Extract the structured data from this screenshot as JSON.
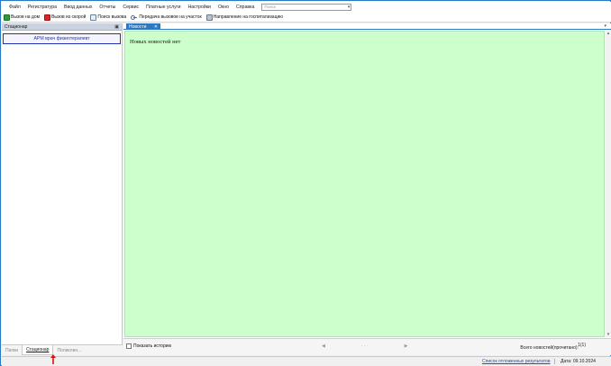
{
  "menu": {
    "items": [
      "Файл",
      "Регистратура",
      "Ввод данных",
      "Отчеты",
      "Сервис",
      "Платные услуги",
      "Настройки",
      "Окно",
      "Справка"
    ],
    "search_placeholder": "Поиск"
  },
  "toolbar": {
    "home_call": "Вызов на дом",
    "ambulance_call": "Вызов из скорой",
    "call_search": "Поиск вызова",
    "transfer_calls": "Передача вызовов на участок",
    "hospital_referral": "Направление на госпитализацию"
  },
  "left_panel": {
    "title": "Стационар",
    "workplace_button": "АРМ врач физиотерапевт",
    "tabs": [
      "Папки",
      "Стационар",
      "Поликлин..."
    ]
  },
  "main": {
    "tab_label": "Новости",
    "empty_message": "Новых новостей нет",
    "show_history_label": "Показать историю",
    "total_news_label": "Всего новостей(прочитано):",
    "total_news_value": "1(1)"
  },
  "statusbar": {
    "deferred_results_link": "Список отложенных результатов",
    "date_label": "Дата: 09.10.2024"
  },
  "colors": {
    "accent": "#2b79c2",
    "content_bg": "#ccffcc",
    "workplace_border": "#1f33b8"
  }
}
